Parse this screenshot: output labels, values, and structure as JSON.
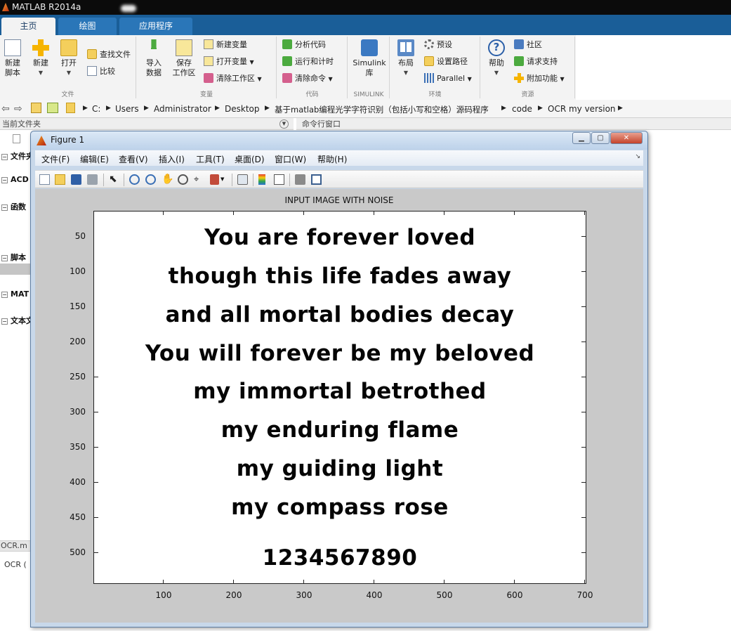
{
  "app": {
    "title": "MATLAB R2014a"
  },
  "tabs": [
    "主页",
    "绘图",
    "应用程序"
  ],
  "ribbon": {
    "file": {
      "label": "文件",
      "new_script": [
        "新建",
        "脚本"
      ],
      "new": "新建",
      "open": "打开",
      "find_files": "查找文件",
      "compare": "比较"
    },
    "variable": {
      "label": "变量",
      "import": [
        "导入",
        "数据"
      ],
      "save_ws": [
        "保存",
        "工作区"
      ],
      "new_var": "新建变量",
      "open_var": "打开变量",
      "clear_ws": "清除工作区"
    },
    "code": {
      "label": "代码",
      "analyze": "分析代码",
      "run_time": "运行和计时",
      "clear_cmd": "清除命令"
    },
    "simulink": {
      "label": "SIMULINK",
      "lib": [
        "Simulink",
        "库"
      ]
    },
    "env": {
      "label": "环境",
      "layout": "布局",
      "prefs": "预设",
      "set_path": "设置路径",
      "parallel": "Parallel"
    },
    "resources": {
      "label": "资源",
      "help": "帮助",
      "community": "社区",
      "request_support": "请求支持",
      "addons": "附加功能"
    }
  },
  "address": {
    "crumbs": [
      "C:",
      "Users",
      "Administrator",
      "Desktop",
      "基于matlab编程光学字符识别（包括小写和空格）源码程序",
      "code",
      "OCR my version"
    ]
  },
  "panes": {
    "current_folder": "当前文件夹",
    "command_window": "命令行窗口"
  },
  "left_tree": [
    "文件夹",
    "ACD",
    "函数",
    "脚本",
    "MAT",
    "文本文"
  ],
  "left_bottom": [
    "OCR.m",
    "OCR ("
  ],
  "figure": {
    "title": "Figure 1",
    "menu": [
      "文件(F)",
      "编辑(E)",
      "查看(V)",
      "插入(I)",
      "工具(T)",
      "桌面(D)",
      "窗口(W)",
      "帮助(H)"
    ],
    "plot_title": "INPUT IMAGE WITH NOISE",
    "image_text": [
      "You are forever loved",
      "though this life fades away",
      "and all mortal bodies decay",
      "You will forever be my beloved",
      "my immortal betrothed",
      "my enduring flame",
      "my guiding light",
      "my compass rose",
      "1234567890"
    ],
    "x_ticks": [
      "100",
      "200",
      "300",
      "400",
      "500",
      "600",
      "700"
    ],
    "y_ticks": [
      "50",
      "100",
      "150",
      "200",
      "250",
      "300",
      "350",
      "400",
      "450",
      "500"
    ]
  }
}
